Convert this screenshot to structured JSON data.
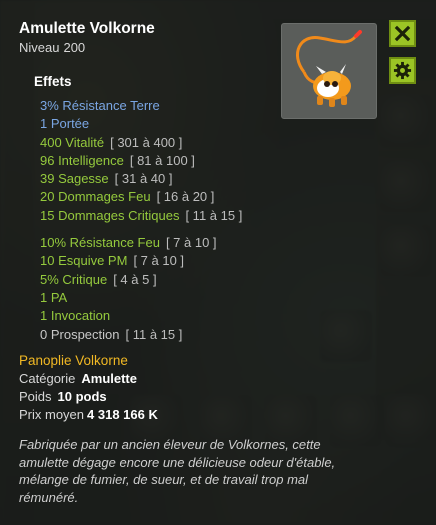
{
  "item": {
    "name": "Amulette Volkorne",
    "level_label": "Niveau",
    "level": "200"
  },
  "buttons": {
    "close_icon": "close-icon",
    "settings_icon": "gear-icon"
  },
  "effects": {
    "title": "Effets",
    "lines": [
      {
        "text": "3% Résistance Terre",
        "range": "",
        "color": "#7aa6e3"
      },
      {
        "text": "1 Portée",
        "range": "",
        "color": "#7aa6e3"
      },
      {
        "text": "400 Vitalité",
        "range": "[ 301 à 400 ]",
        "color": "#95ca3d"
      },
      {
        "text": "96 Intelligence",
        "range": "[ 81 à 100 ]",
        "color": "#95ca3d"
      },
      {
        "text": "39 Sagesse",
        "range": "[ 31 à 40 ]",
        "color": "#95ca3d"
      },
      {
        "text": "20 Dommages Feu",
        "range": "[ 16 à 20 ]",
        "color": "#95ca3d"
      },
      {
        "text": "15 Dommages Critiques",
        "range": "[ 11 à 15 ]",
        "color": "#95ca3d"
      },
      {
        "text": "10% Résistance Feu",
        "range": "[ 7 à 10 ]",
        "color": "#95ca3d"
      },
      {
        "text": "10 Esquive PM",
        "range": "[ 7 à 10 ]",
        "color": "#95ca3d"
      },
      {
        "text": "5% Critique",
        "range": "[ 4 à 5 ]",
        "color": "#95ca3d"
      },
      {
        "text": "1 PA",
        "range": "",
        "color": "#95ca3d"
      },
      {
        "text": "1 Invocation",
        "range": "",
        "color": "#95ca3d"
      },
      {
        "text": "0 Prospection",
        "range": "[ 11 à 15 ]",
        "color": "#c8c8c8"
      }
    ]
  },
  "info": {
    "set_name": "Panoplie Volkorne",
    "category_label": "Catégorie",
    "category_value": "Amulette",
    "weight_label": "Poids",
    "weight_value": "10 pods",
    "price_label": "Prix moyen",
    "price_value": "4 318 166 K"
  },
  "description": "Fabriquée par un ancien éleveur de Volkornes, cette amulette dégage encore une délicieuse odeur d'étable, mélange de fumier, de sueur, et de travail trop mal rémunéré.",
  "colors": {
    "accent_green_button": "#9bc425",
    "set_name_color": "#f1b824",
    "bonus_blue": "#7aa6e3",
    "bonus_green": "#95ca3d"
  }
}
